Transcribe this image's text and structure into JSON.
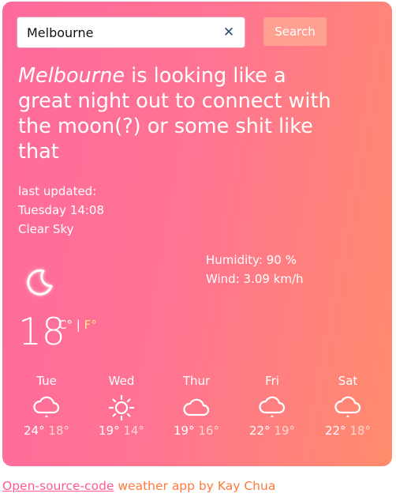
{
  "search": {
    "value": "Melbourne",
    "clear_icon": "close-icon",
    "button_label": "Search"
  },
  "headline": {
    "city": "Melbourne",
    "rest": " is looking like a great night out to connect with the moon(?) or some shit like that"
  },
  "meta": {
    "last_updated_label": "last updated:",
    "last_updated_value": "Tuesday 14:08",
    "description": "Clear Sky"
  },
  "details": {
    "humidity": "Humidity: 90 %",
    "wind": "Wind: 3.09 km/h"
  },
  "current": {
    "icon": "moon-icon",
    "temperature": "18",
    "unit_c": "C°",
    "separator": "|",
    "unit_f": "F°"
  },
  "forecast": [
    {
      "day": "Tue",
      "icon": "cloud-rain-icon",
      "high": "24°",
      "low": "18°"
    },
    {
      "day": "Wed",
      "icon": "sun-icon",
      "high": "19°",
      "low": "14°"
    },
    {
      "day": "Thur",
      "icon": "cloud-icon",
      "high": "19°",
      "low": "16°"
    },
    {
      "day": "Fri",
      "icon": "cloud-rain-icon",
      "high": "22°",
      "low": "19°"
    },
    {
      "day": "Sat",
      "icon": "cloud-rain-icon",
      "high": "22°",
      "low": "18°"
    }
  ],
  "footer": {
    "link_text": "Open-source-code",
    "text": " weather app by Kay Chua"
  },
  "colors": {
    "card_gradient_start": "#ff6a9c",
    "card_gradient_end": "#ff8c6c",
    "unit_highlight": "#ffe680",
    "footer_text": "#ff7a3d",
    "footer_link": "#ff5a95"
  }
}
